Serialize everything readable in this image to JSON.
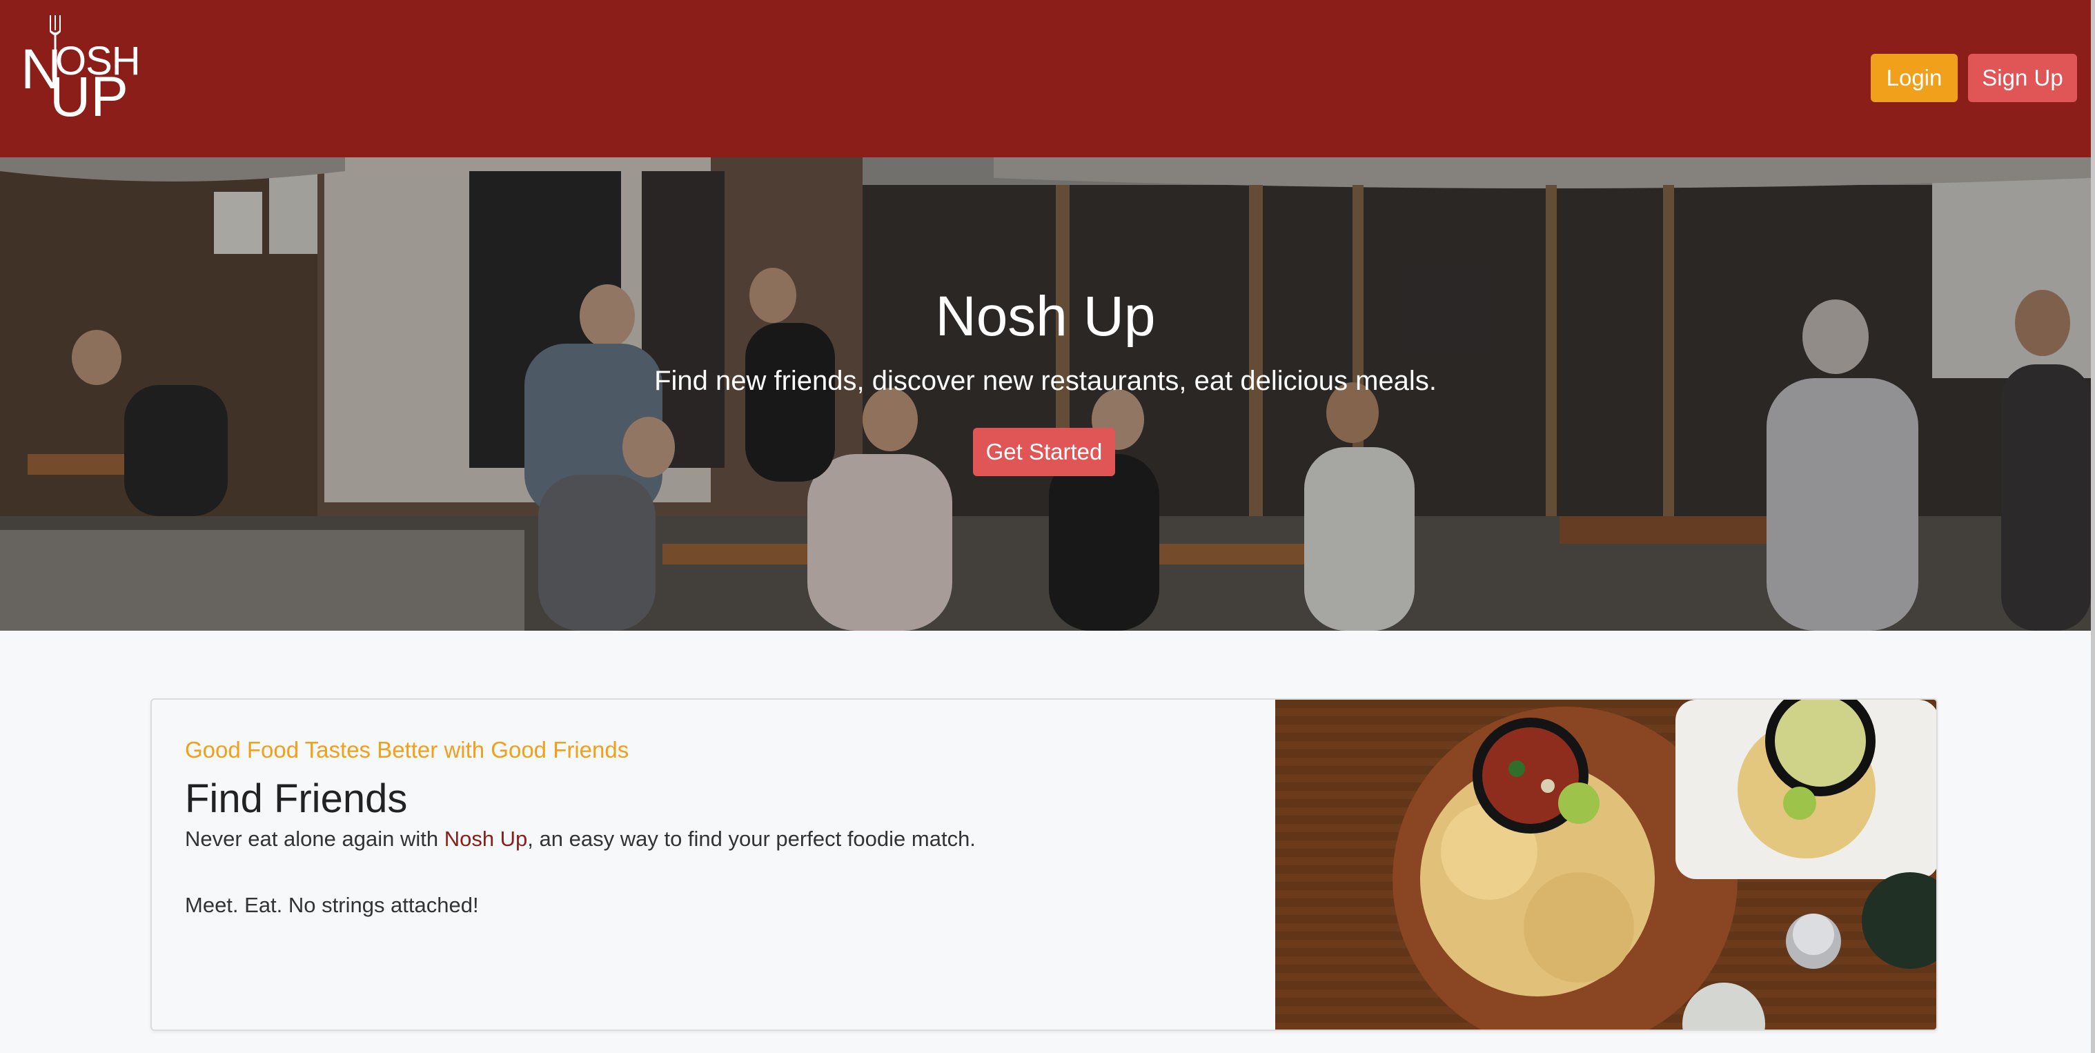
{
  "navbar": {
    "logo": {
      "line1_initial": "N",
      "line1_rest": "OSH",
      "line2": "UP",
      "icon": "fork-icon"
    },
    "login_label": "Login",
    "signup_label": "Sign Up",
    "background_color": "#8b1e18"
  },
  "hero": {
    "title": "Nosh Up",
    "tagline": "Find new friends, discover new restaurants, eat delicious meals.",
    "cta_label": "Get Started"
  },
  "feature_card": {
    "kicker": "Good Food Tastes Better with Good Friends",
    "heading": "Find Friends",
    "body_prefix": "Never eat alone again with ",
    "body_brand": "Nosh Up",
    "body_suffix": ", an easy way to find your perfect foodie match.",
    "body_second": "Meet. Eat. No strings attached!"
  },
  "colors": {
    "brand_red": "#8b1e18",
    "accent_orange": "#f0a01a",
    "button_red": "#e05656"
  }
}
